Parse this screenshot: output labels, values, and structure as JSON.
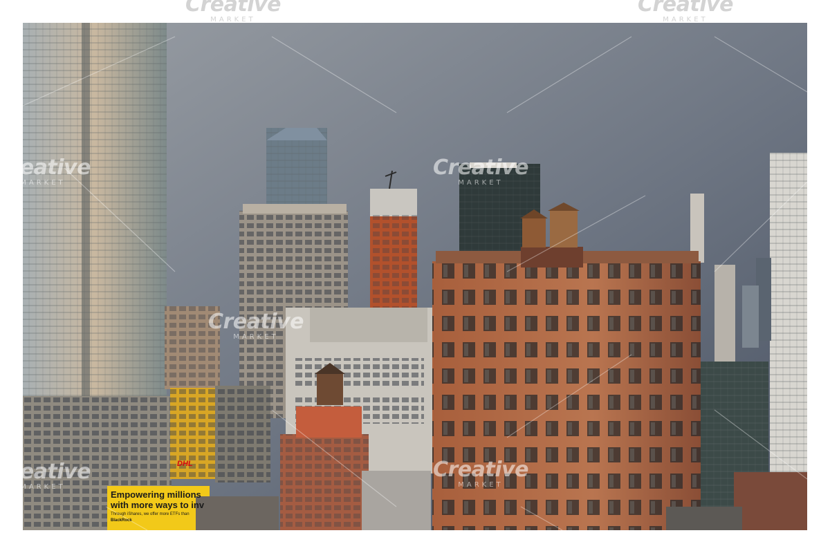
{
  "watermark": {
    "brand": "Creative",
    "sub": "MARKET"
  },
  "billboard": {
    "headline": "Empowering millions with more ways to inv",
    "body": "Through iShares, we offer more ETFs than",
    "brand": "BlackRock"
  },
  "dhl_sign": {
    "text": "DHL"
  },
  "colors": {
    "sky_top": "#8d939b",
    "sky_bottom": "#4f5867",
    "brick": "#9a5a3c",
    "glass": "#8a9aa6"
  }
}
